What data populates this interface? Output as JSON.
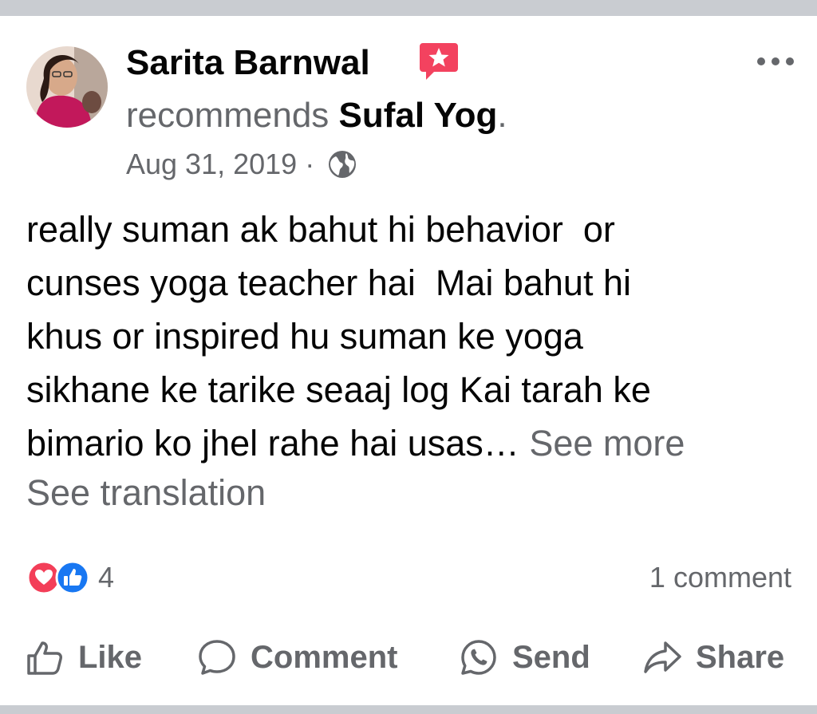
{
  "post": {
    "author": "Sarita Barnwal",
    "recommends_text": "recommends ",
    "page_name": "Sufal Yog",
    "page_suffix": ".",
    "date": "Aug 31, 2019",
    "separator": " · ",
    "privacy_icon": "globe-icon",
    "body_lines": [
      "really suman ak bahut hi behavior  or",
      "cunses yoga teacher hai  Mai bahut hi",
      "khus or inspired hu suman ke yoga",
      "sikhane ke tarike seaaj log Kai tarah ke",
      "bimario ko jhel rahe hai usas… "
    ],
    "see_more": "See more",
    "see_translation": "See translation"
  },
  "stats": {
    "reaction_icons": [
      "love-reaction-icon",
      "like-reaction-icon"
    ],
    "reaction_count": "4",
    "comment_count": "1 comment"
  },
  "actions": {
    "like": "Like",
    "comment": "Comment",
    "send": "Send",
    "share": "Share"
  },
  "colors": {
    "secondary_text": "#65676b",
    "primary_text": "#050505",
    "like_blue": "#1877f2",
    "love_red": "#f33e58",
    "recommend_badge": "#f3425f",
    "divider": "#c9ccd1"
  }
}
